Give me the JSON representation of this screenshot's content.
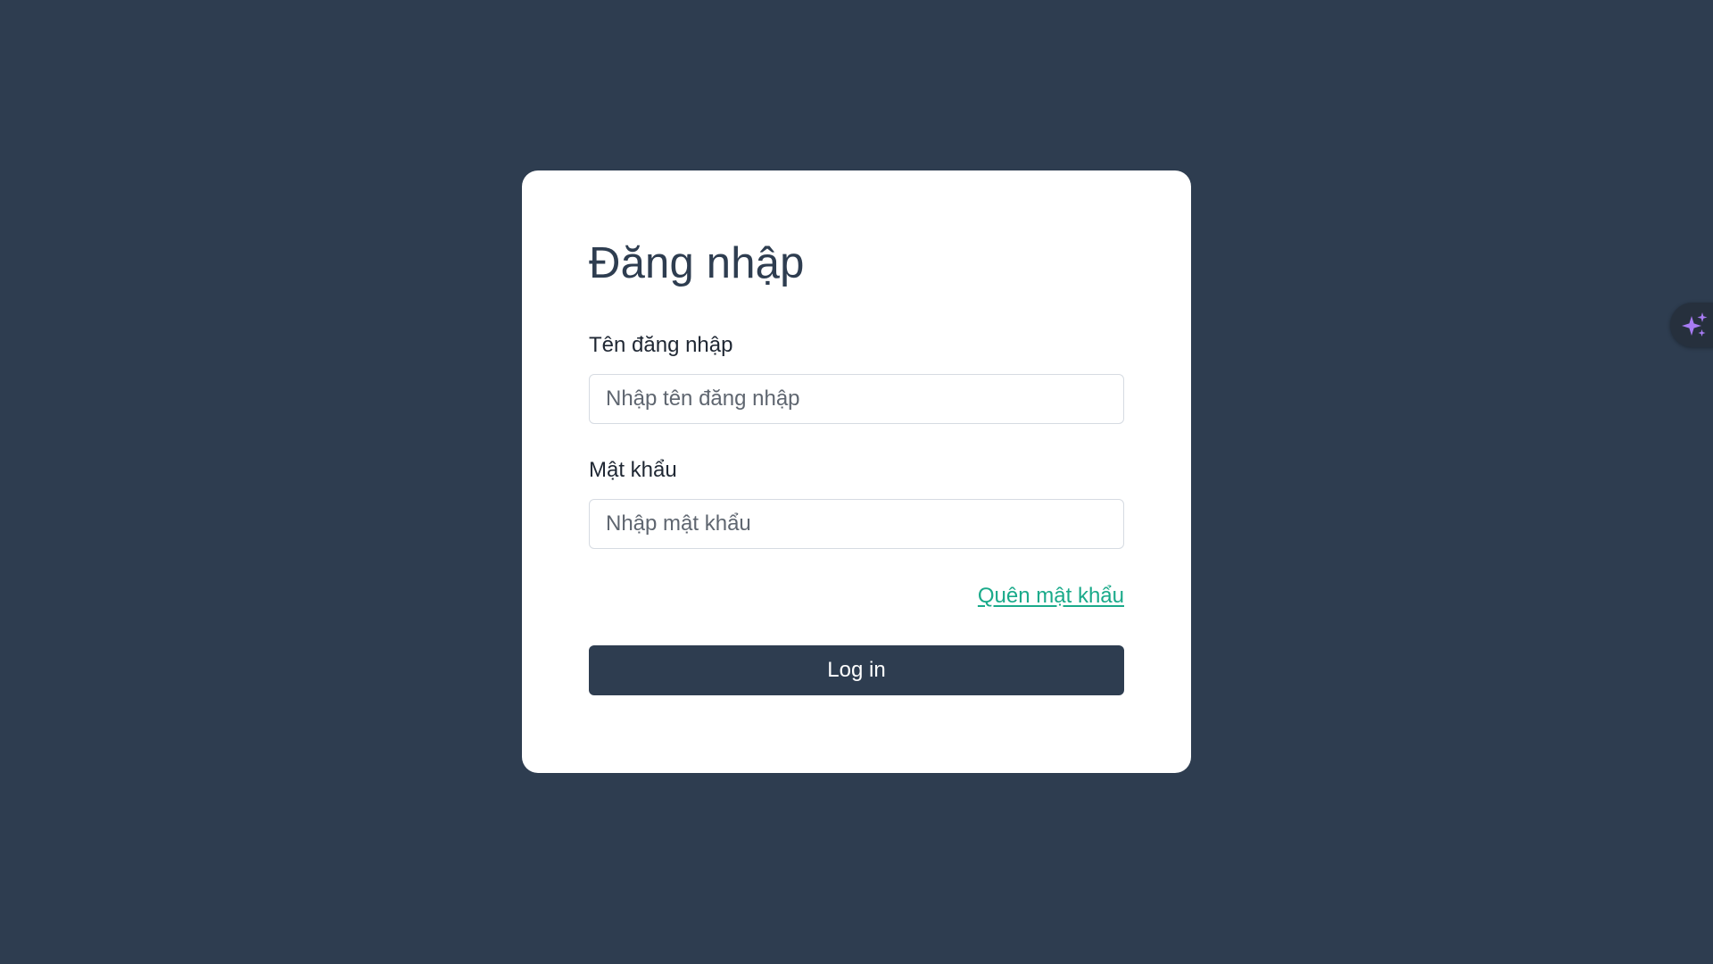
{
  "login": {
    "title": "Đăng nhập",
    "username_label": "Tên đăng nhập",
    "username_placeholder": "Nhập tên đăng nhập",
    "username_value": "",
    "password_label": "Mật khẩu",
    "password_placeholder": "Nhập mật khẩu",
    "password_value": "",
    "forgot_password_link": "Quên mật khẩu",
    "submit_button": "Log in"
  },
  "floating_button": {
    "icon": "sparkles-icon"
  },
  "colors": {
    "background": "#2e3d50",
    "card": "#ffffff",
    "primary": "#2e3d50",
    "link": "#1aaa8a",
    "sparkle": "#a77bf3"
  }
}
